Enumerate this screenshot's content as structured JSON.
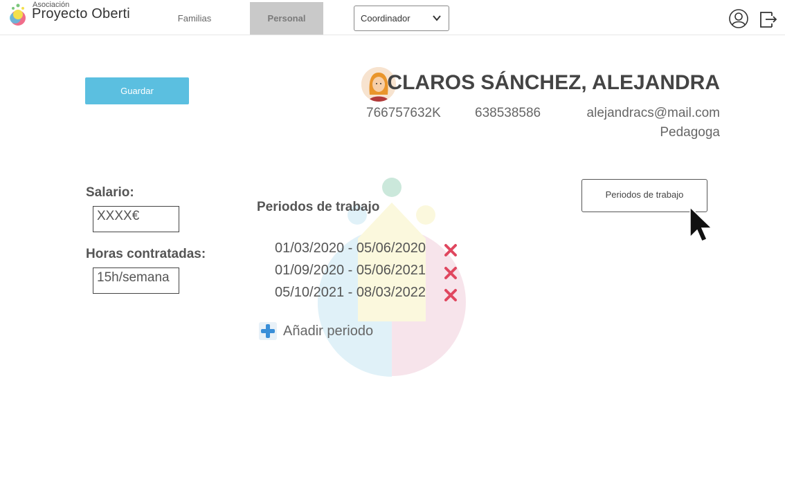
{
  "header": {
    "logo_small": "Asociación",
    "logo_big": "Proyecto Oberti",
    "tabs": [
      {
        "label": "Familias",
        "active": false
      },
      {
        "label": "Personal",
        "active": true
      }
    ],
    "role_select": {
      "value": "Coordinador"
    },
    "icons": [
      "user-icon",
      "logout-icon"
    ]
  },
  "actions": {
    "save_label": "Guardar",
    "periods_button_label": "Periodos de trabajo"
  },
  "profile": {
    "name": "CLAROS SÁNCHEZ, ALEJANDRA",
    "id_number": "766757632K",
    "phone": "638538586",
    "email": "alejandracs@mail.com",
    "role": "Pedagoga"
  },
  "employment": {
    "salary_label": "Salario:",
    "salary_value": "XXXX€",
    "hours_label": "Horas contratadas:",
    "hours_value": "15h/semana"
  },
  "periods": {
    "title": "Periodos de trabajo",
    "items": [
      {
        "range": "01/03/2020 - 05/06/2020"
      },
      {
        "range": "01/09/2020 - 05/06/2021"
      },
      {
        "range": "05/10/2021 - 08/03/2022"
      }
    ],
    "add_label": "Añadir periodo"
  },
  "colors": {
    "accent": "#5bbfe0",
    "delete": "#e0475f",
    "add": "#3a8fd8"
  }
}
